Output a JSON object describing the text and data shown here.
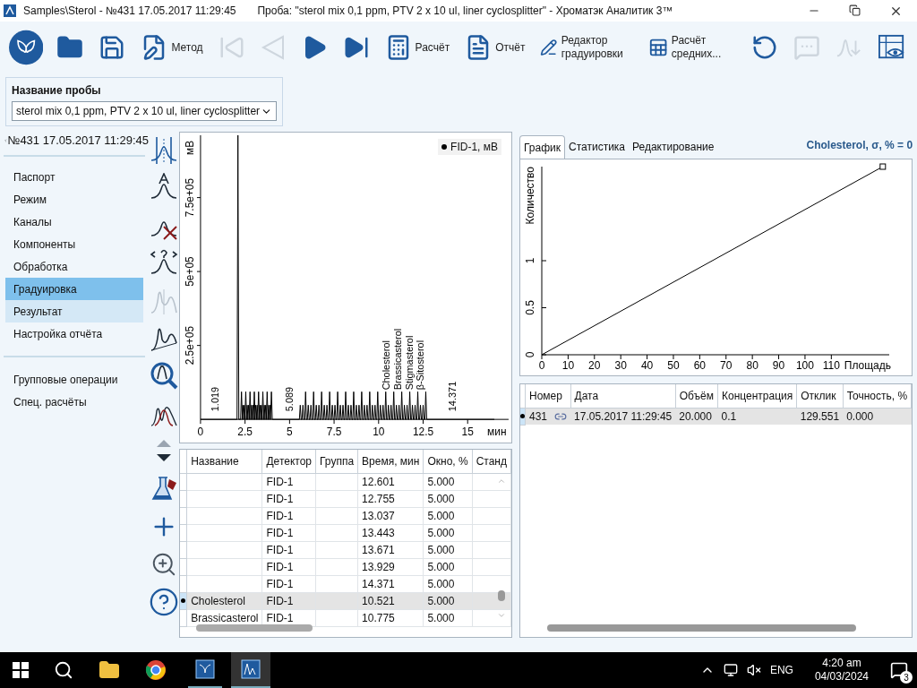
{
  "window": {
    "title_path": "Samples\\Sterol - №431 17.05.2017 11:29:45",
    "title_sample": "Проба: \"sterol mix 0,1 ppm, PTV 2 x 10 ul, liner cyclosplitter\" - Хроматэк Аналитик 3™"
  },
  "toolbar": [
    {
      "kind": "app"
    },
    {
      "kind": "open",
      "disabled": false
    },
    {
      "kind": "save",
      "disabled": false
    },
    {
      "kind": "method",
      "label": "Метод",
      "disabled": false
    },
    {
      "kind": "first",
      "disabled": true
    },
    {
      "kind": "prev",
      "disabled": true
    },
    {
      "kind": "next",
      "disabled": false
    },
    {
      "kind": "last",
      "disabled": false
    },
    {
      "kind": "calc",
      "label": "Расчёт",
      "disabled": false
    },
    {
      "kind": "report",
      "label": "Отчёт",
      "disabled": false
    },
    {
      "kind": "calib",
      "label": "Редактор градуировки",
      "disabled": false
    },
    {
      "kind": "average",
      "label": "Расчёт средних...",
      "disabled": false
    },
    {
      "kind": "undo",
      "disabled": false
    },
    {
      "kind": "comment",
      "disabled": true
    },
    {
      "kind": "merge",
      "disabled": true
    },
    {
      "kind": "view",
      "disabled": false
    }
  ],
  "sample_name": {
    "label": "Название пробы",
    "value": "sterol mix 0,1 ppm, PTV 2 x 10 ul, liner cyclosplitter"
  },
  "nav": {
    "back": "№431 17.05.2017 11:29:45",
    "items": [
      {
        "label": "Паспорт",
        "selected": false,
        "hovered": false
      },
      {
        "label": "Режим",
        "selected": false,
        "hovered": false
      },
      {
        "label": "Каналы",
        "selected": false,
        "hovered": false
      },
      {
        "label": "Компоненты",
        "selected": false,
        "hovered": false
      },
      {
        "label": "Обработка",
        "selected": false,
        "hovered": false
      },
      {
        "label": "Градуировка",
        "selected": true,
        "hovered": false
      },
      {
        "label": "Результат",
        "selected": false,
        "hovered": true
      },
      {
        "label": "Настройка отчёта",
        "selected": false,
        "hovered": false
      }
    ],
    "extra": [
      "Групповые операции",
      "Спец. расчёты"
    ]
  },
  "tools": [
    {
      "kind": "split",
      "disabled": false
    },
    {
      "kind": "name",
      "disabled": false
    },
    {
      "kind": "delete",
      "disabled": false
    },
    {
      "kind": "identify",
      "disabled": false
    },
    {
      "kind": "separate",
      "disabled": true
    },
    {
      "kind": "baseline",
      "disabled": false
    },
    {
      "kind": "zoom",
      "disabled": false
    },
    {
      "kind": "overlay",
      "disabled": false
    },
    {
      "kind": "updown",
      "disabled": false
    },
    {
      "kind": "flask",
      "disabled": false
    },
    {
      "kind": "add",
      "disabled": false
    },
    {
      "kind": "zoomtool",
      "disabled": false
    },
    {
      "kind": "help",
      "disabled": false
    }
  ],
  "chromatogram": {
    "y_unit": "мВ",
    "x_unit": "мин",
    "legend": "FID-1, мВ",
    "xticks": [
      "0",
      "2.5",
      "5",
      "7.5",
      "10",
      "12.5",
      "15"
    ],
    "yticks": [
      "2.5e+05",
      "5e+05",
      "7.5e+05"
    ],
    "peak_labels": [
      "1.019",
      "5.089",
      "Cholesterol",
      "Brassicasterol",
      "Stigmasterol",
      "β-Sitosterol",
      "14.371"
    ]
  },
  "components": {
    "columns": [
      "Название",
      "Детектор",
      "Группа",
      "Время, мин",
      "Окно, %",
      "Станд"
    ],
    "rows": [
      {
        "cells": [
          "",
          "FID-1",
          "",
          "12.601",
          "5.000",
          ""
        ],
        "selected": false
      },
      {
        "cells": [
          "",
          "FID-1",
          "",
          "12.755",
          "5.000",
          ""
        ],
        "selected": false
      },
      {
        "cells": [
          "",
          "FID-1",
          "",
          "13.037",
          "5.000",
          ""
        ],
        "selected": false
      },
      {
        "cells": [
          "",
          "FID-1",
          "",
          "13.443",
          "5.000",
          ""
        ],
        "selected": false
      },
      {
        "cells": [
          "",
          "FID-1",
          "",
          "13.671",
          "5.000",
          ""
        ],
        "selected": false
      },
      {
        "cells": [
          "",
          "FID-1",
          "",
          "13.929",
          "5.000",
          ""
        ],
        "selected": false
      },
      {
        "cells": [
          "",
          "FID-1",
          "",
          "14.371",
          "5.000",
          ""
        ],
        "selected": false
      },
      {
        "cells": [
          "Cholesterol",
          "FID-1",
          "",
          "10.521",
          "5.000",
          ""
        ],
        "selected": true
      },
      {
        "cells": [
          "Brassicasterol",
          "FID-1",
          "",
          "10.775",
          "5.000",
          ""
        ],
        "selected": false
      }
    ]
  },
  "right": {
    "tabs": [
      {
        "label": "График",
        "selected": true
      },
      {
        "label": "Статистика",
        "selected": false
      },
      {
        "label": "Редактирование",
        "selected": false
      }
    ],
    "heading": "Cholesterol,  σ, % = 0",
    "chart_data": {
      "type": "line",
      "xlabel": "Площадь",
      "ylabel": "Количество",
      "x": [
        0,
        129.551
      ],
      "series": [
        {
          "color": "#000000",
          "values": [
            0,
            2
          ]
        }
      ],
      "xlim": [
        0,
        132
      ],
      "ylim": [
        0,
        2
      ],
      "xticks": [
        {
          "value": 0,
          "label": "0"
        },
        10,
        20,
        30,
        40,
        50,
        60,
        70,
        80,
        90,
        100,
        110
      ],
      "yticks": [
        {
          "value": 0,
          "label": "0"
        },
        {
          "value": 0.5,
          "label": "0.5"
        },
        1
      ]
    },
    "results": {
      "columns": [
        "Номер",
        "Дата",
        "Объём",
        "Концентрация",
        "Отклик",
        "Точность, %"
      ],
      "rows": [
        {
          "cells": [
            "431",
            "17.05.2017 11:29:45",
            "20.000",
            "0.1",
            "129.551",
            "0.000"
          ],
          "linked": true,
          "selected": true
        }
      ]
    }
  },
  "taskbar": {
    "language": "ENG",
    "time": "4:20 am",
    "date": "04/03/2024",
    "notifications": "3"
  }
}
